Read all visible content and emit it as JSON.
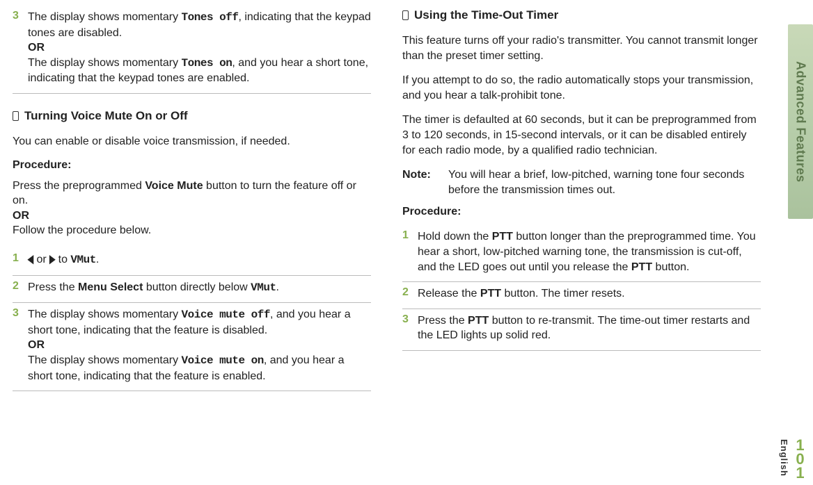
{
  "left": {
    "step3": {
      "num": "3",
      "line1a": "The display shows momentary ",
      "tonesOff": "Tones off",
      "line1b": ", indicating that the keypad tones are disabled.",
      "or": "OR",
      "line2a": "The display shows momentary ",
      "tonesOn": "Tones on",
      "line2b": ", and you hear a short tone, indicating that the keypad tones are enabled."
    },
    "sectionA": {
      "title": "Turning Voice Mute On or Off",
      "p1": "You can enable or disable voice transmission, if needed.",
      "proc": "Procedure:",
      "p2a": "Press the preprogrammed ",
      "p2b": "Voice Mute",
      "p2c": " button to turn the feature off or on.",
      "or": "OR",
      "p3": "Follow the procedure below.",
      "s1": {
        "num": "1",
        "a": " or ",
        "b": " to ",
        "vmut": "VMut",
        "dot": "."
      },
      "s2": {
        "num": "2",
        "a": "Press the ",
        "ms": "Menu Select",
        "b": " button directly below ",
        "vmut": "VMut",
        "dot": "."
      },
      "s3": {
        "num": "3",
        "a": "The display shows momentary ",
        "vmoff": "Voice mute off",
        "b": ", and you hear a short tone, indicating that the feature is disabled.",
        "or": "OR",
        "c": "The display shows momentary ",
        "vmon": "Voice mute on",
        "d": ", and you hear a short tone, indicating that the feature is enabled."
      }
    }
  },
  "right": {
    "sectionB": {
      "title": "Using the Time-Out Timer",
      "p1": "This feature turns off your radio's transmitter. You cannot transmit longer than the preset timer setting.",
      "p2": "If you attempt to do so, the radio automatically stops your transmission, and you hear a talk-prohibit tone.",
      "p3": "The timer is defaulted at 60 seconds, but it can be preprogrammed from 3 to 120 seconds, in 15-second intervals, or it can be disabled entirely for each radio mode, by a qualified radio technician.",
      "noteLabel": "Note:",
      "noteText": "You will hear a brief, low-pitched, warning tone four seconds before the transmission times out.",
      "proc": "Procedure:",
      "s1": {
        "num": "1",
        "a": "Hold down the ",
        "ptt": "PTT",
        "b": " button longer than the preprogrammed time. You hear a short, low-pitched warning tone, the transmission is cut-off, and the LED goes out until you release the ",
        "c": " button."
      },
      "s2": {
        "num": "2",
        "a": "Release the ",
        "ptt": "PTT",
        "b": " button. The timer resets."
      },
      "s3": {
        "num": "3",
        "a": "Press the ",
        "ptt": "PTT",
        "b": " button to re-transmit. The time-out timer restarts and the LED lights up solid red."
      }
    }
  },
  "side": {
    "tab": "Advanced Features",
    "lang": "English",
    "page": "101"
  }
}
